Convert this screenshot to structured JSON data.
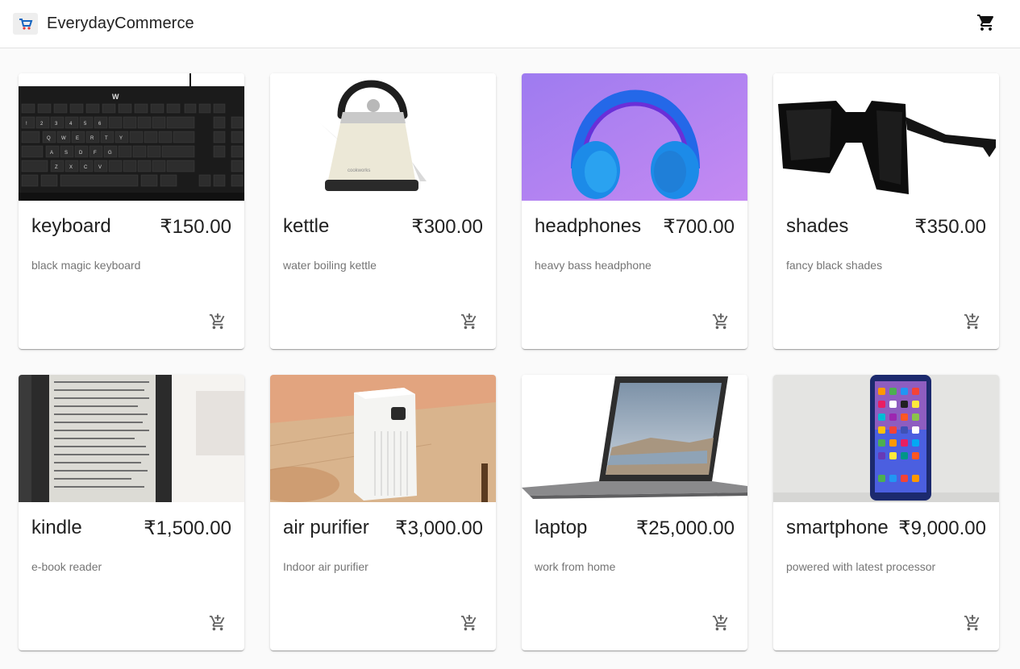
{
  "header": {
    "title": "EverydayCommerce",
    "logo_icon": "shopping-cart-logo-icon",
    "cart_icon": "shopping-cart-icon"
  },
  "colors": {
    "appbar_bg": "#ffffff",
    "page_bg": "#fafafa",
    "text_primary": "#212121",
    "text_secondary": "#757575"
  },
  "products": [
    {
      "name": "keyboard",
      "price": "₹150.00",
      "description": "black magic keyboard",
      "image": "keyboard photo",
      "add_icon": "add-shopping-cart-icon"
    },
    {
      "name": "kettle",
      "price": "₹300.00",
      "description": "water boiling kettle",
      "image": "kettle photo",
      "add_icon": "add-shopping-cart-icon"
    },
    {
      "name": "headphones",
      "price": "₹700.00",
      "description": "heavy bass headphone",
      "image": "headphones photo",
      "add_icon": "add-shopping-cart-icon"
    },
    {
      "name": "shades",
      "price": "₹350.00",
      "description": "fancy black shades",
      "image": "sunglasses photo",
      "add_icon": "add-shopping-cart-icon"
    },
    {
      "name": "kindle",
      "price": "₹1,500.00",
      "description": "e-book reader",
      "image": "kindle photo",
      "add_icon": "add-shopping-cart-icon"
    },
    {
      "name": "air purifier",
      "price": "₹3,000.00",
      "description": "Indoor air purifier",
      "image": "air purifier photo",
      "add_icon": "add-shopping-cart-icon"
    },
    {
      "name": "laptop",
      "price": "₹25,000.00",
      "description": "work from home",
      "image": "laptop photo",
      "add_icon": "add-shopping-cart-icon"
    },
    {
      "name": "smartphone",
      "price": "₹9,000.00",
      "description": "powered with latest processor",
      "image": "smartphone photo",
      "add_icon": "add-shopping-cart-icon"
    }
  ]
}
